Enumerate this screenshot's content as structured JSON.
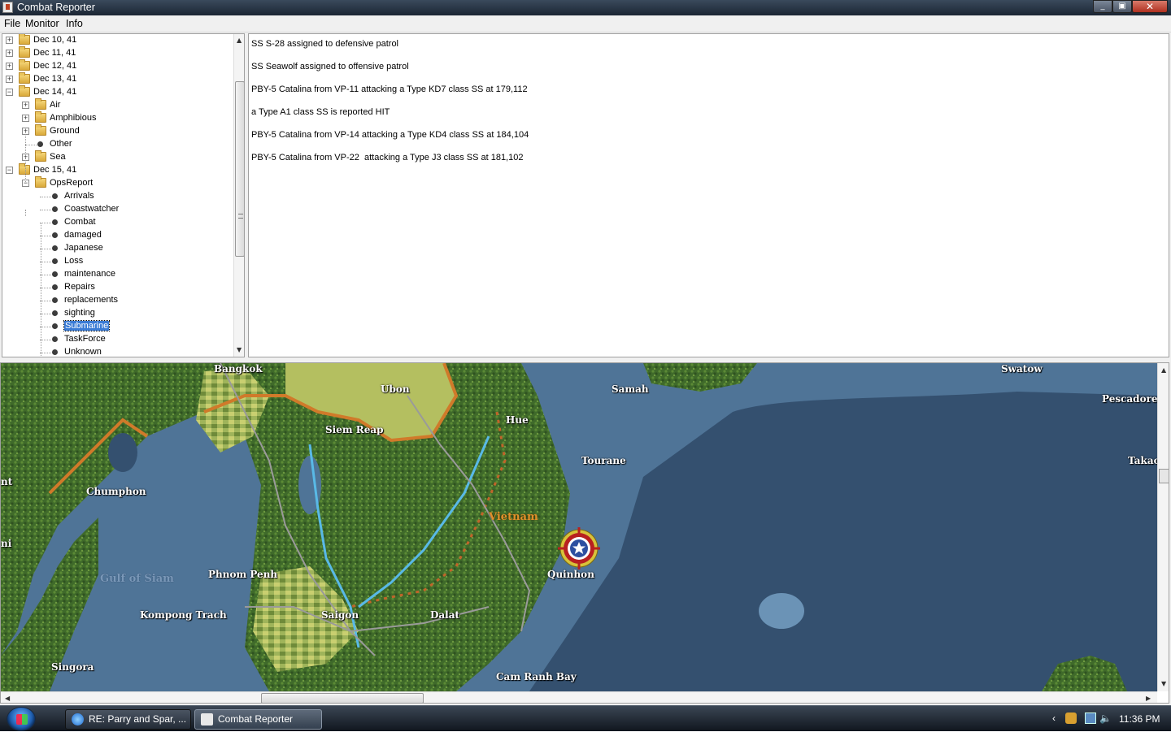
{
  "window": {
    "title": "Combat Reporter"
  },
  "menu": [
    "File",
    "Monitor",
    "Info"
  ],
  "tree": [
    {
      "label": "Dec 10, 41",
      "depth": 0,
      "kind": "folder",
      "expander": "+"
    },
    {
      "label": "Dec 11, 41",
      "depth": 0,
      "kind": "folder",
      "expander": "+"
    },
    {
      "label": "Dec 12, 41",
      "depth": 0,
      "kind": "folder",
      "expander": "+"
    },
    {
      "label": "Dec 13, 41",
      "depth": 0,
      "kind": "folder",
      "expander": "+"
    },
    {
      "label": "Dec 14, 41",
      "depth": 0,
      "kind": "folder",
      "expander": "-"
    },
    {
      "label": "Air",
      "depth": 1,
      "kind": "folder",
      "expander": "+"
    },
    {
      "label": "Amphibious",
      "depth": 1,
      "kind": "folder",
      "expander": "+"
    },
    {
      "label": "Ground",
      "depth": 1,
      "kind": "folder",
      "expander": "+"
    },
    {
      "label": "Other",
      "depth": 1,
      "kind": "leaf",
      "expander": ""
    },
    {
      "label": "Sea",
      "depth": 1,
      "kind": "folder",
      "expander": "+"
    },
    {
      "label": "Dec 15, 41",
      "depth": 0,
      "kind": "folder",
      "expander": "-"
    },
    {
      "label": "OpsReport",
      "depth": 1,
      "kind": "folder",
      "expander": "-"
    },
    {
      "label": "Arrivals",
      "depth": 2,
      "kind": "leaf",
      "expander": ""
    },
    {
      "label": "Coastwatcher",
      "depth": 2,
      "kind": "leaf",
      "expander": ""
    },
    {
      "label": "Combat",
      "depth": 2,
      "kind": "leaf",
      "expander": ""
    },
    {
      "label": "damaged",
      "depth": 2,
      "kind": "leaf",
      "expander": ""
    },
    {
      "label": "Japanese",
      "depth": 2,
      "kind": "leaf",
      "expander": ""
    },
    {
      "label": "Loss",
      "depth": 2,
      "kind": "leaf",
      "expander": ""
    },
    {
      "label": "maintenance",
      "depth": 2,
      "kind": "leaf",
      "expander": ""
    },
    {
      "label": "Repairs",
      "depth": 2,
      "kind": "leaf",
      "expander": ""
    },
    {
      "label": "replacements",
      "depth": 2,
      "kind": "leaf",
      "expander": ""
    },
    {
      "label": "sighting",
      "depth": 2,
      "kind": "leaf",
      "expander": ""
    },
    {
      "label": "Submarine",
      "depth": 2,
      "kind": "leaf",
      "expander": "",
      "selected": true
    },
    {
      "label": "TaskForce",
      "depth": 2,
      "kind": "leaf",
      "expander": ""
    },
    {
      "label": "Unknown",
      "depth": 2,
      "kind": "leaf",
      "expander": ""
    }
  ],
  "report_lines": [
    "SS S-28 assigned to defensive patrol",
    "SS Seawolf assigned to offensive patrol",
    "PBY-5 Catalina from VP-11 attacking a Type KD7 class SS at 179,112",
    "a Type A1 class SS is reported HIT",
    "PBY-5 Catalina from VP-14 attacking a Type KD4 class SS at 184,104",
    "PBY-5 Catalina from VP-22  attacking a Type J3 class SS at 181,102"
  ],
  "map_labels": [
    {
      "text": "Bangkok",
      "kind": "city"
    },
    {
      "text": "Ubon",
      "kind": "city"
    },
    {
      "text": "Samah",
      "kind": "city"
    },
    {
      "text": "Swatow",
      "kind": "city"
    },
    {
      "text": "Pescadores",
      "kind": "city"
    },
    {
      "text": "Hue",
      "kind": "city"
    },
    {
      "text": "Siem Reap",
      "kind": "city"
    },
    {
      "text": "Tourane",
      "kind": "city"
    },
    {
      "text": "Takao",
      "kind": "city"
    },
    {
      "text": "nt",
      "kind": "city"
    },
    {
      "text": "Chumphon",
      "kind": "city"
    },
    {
      "text": "Vietnam",
      "kind": "country"
    },
    {
      "text": "ni",
      "kind": "city"
    },
    {
      "text": "Phnom Penh",
      "kind": "city"
    },
    {
      "text": "Quinhon",
      "kind": "city"
    },
    {
      "text": "Gulf of Siam",
      "kind": "sea"
    },
    {
      "text": "Kompong Trach",
      "kind": "city"
    },
    {
      "text": "Saigon",
      "kind": "city"
    },
    {
      "text": "Dalat",
      "kind": "city"
    },
    {
      "text": "Singora",
      "kind": "city"
    },
    {
      "text": "Cam Ranh Bay",
      "kind": "city"
    }
  ],
  "taskbar": {
    "buttons": [
      {
        "label": "RE: Parry and Spar, ...",
        "icon": "ie-icon",
        "active": false
      },
      {
        "label": "Combat Reporter",
        "icon": "java-icon",
        "active": true
      }
    ],
    "clock": "11:36 PM"
  },
  "colors": {
    "sea_deep": "#34506f",
    "sea_coast": "#4f7497",
    "land_forest": "#3f6a2a",
    "land_open": "#a8b860",
    "road": "#9a9a9a",
    "river": "#59b9e6",
    "border": "#d07a2a",
    "selection": "#3a7bd5"
  }
}
